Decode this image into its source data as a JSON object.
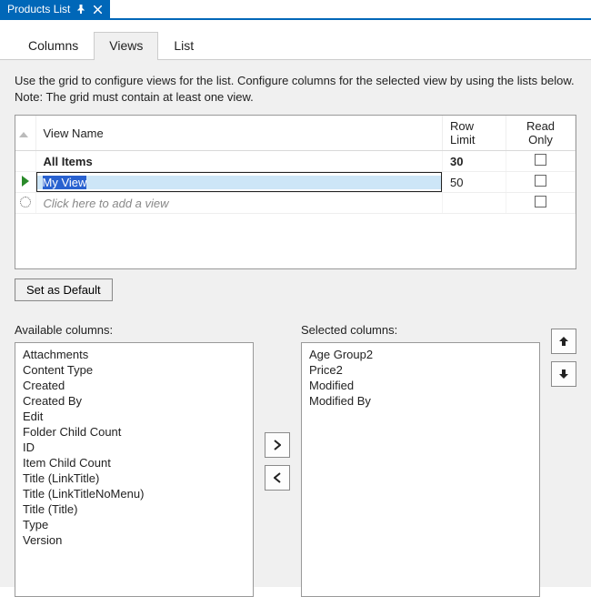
{
  "titlebar": {
    "title": "Products List"
  },
  "tabs": {
    "columns": "Columns",
    "views": "Views",
    "list": "List",
    "active": "views"
  },
  "intro": {
    "line1": "Use the grid to configure views for the list. Configure columns for the selected view by using the lists below.",
    "line2": "Note: The grid must contain at least one view."
  },
  "grid": {
    "headers": {
      "viewName": "View Name",
      "rowLimit": "Row Limit",
      "readOnly": "Read Only"
    },
    "rows": [
      {
        "name": "All Items",
        "rowLimit": "30",
        "readOnly": false,
        "bold": true
      },
      {
        "name": "My View",
        "rowLimit": "50",
        "readOnly": false,
        "editing": true,
        "current": true
      }
    ],
    "addRowPlaceholder": "Click here to add a view"
  },
  "buttons": {
    "setDefault": "Set as Default"
  },
  "columns": {
    "availableLabel": "Available columns:",
    "selectedLabel": "Selected columns:",
    "available": [
      "Attachments",
      "Content Type",
      "Created",
      "Created By",
      "Edit",
      "Folder Child Count",
      "ID",
      "Item Child Count",
      "Title (LinkTitle)",
      "Title (LinkTitleNoMenu)",
      "Title (Title)",
      "Type",
      "Version"
    ],
    "selected": [
      "Age Group2",
      "Price2",
      "Modified",
      "Modified By"
    ]
  }
}
